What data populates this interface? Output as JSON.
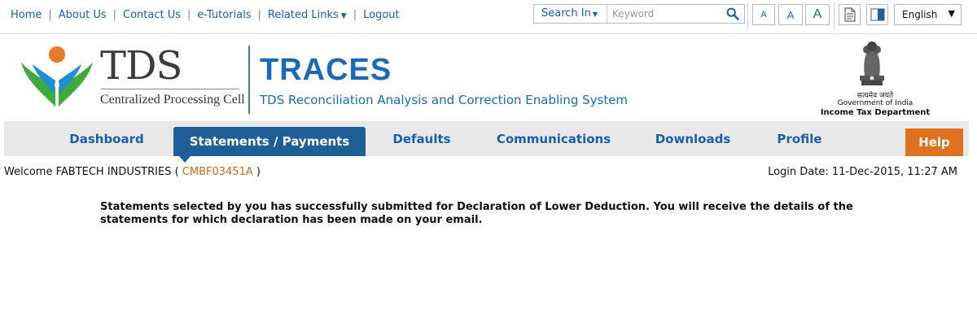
{
  "top_links": {
    "home": "Home",
    "about": "About Us",
    "contact": "Contact Us",
    "tutorials": "e-Tutorials",
    "related": "Related Links",
    "logout": "Logout"
  },
  "search": {
    "scope_label": "Search In",
    "placeholder": "Keyword",
    "value": ""
  },
  "font_size_buttons": [
    "A",
    "A",
    "A"
  ],
  "language": {
    "selected": "English"
  },
  "header": {
    "tds_logo_text": "TDS",
    "tds_sub": "Centralized Processing Cell",
    "title": "TRACES",
    "subtitle": "TDS Reconciliation Analysis and Correction Enabling System",
    "emblem_hindi": "सत्यमेव जयते",
    "gov": "Government of India",
    "dept": "Income Tax Department"
  },
  "nav": {
    "items": [
      "Dashboard",
      "Statements / Payments",
      "Defaults",
      "Communications",
      "Downloads",
      "Profile"
    ],
    "active": "Statements / Payments",
    "help": "Help"
  },
  "welcome": {
    "prefix": "Welcome FABTECH INDUSTRIES (",
    "tan": "CMBF03451A",
    "suffix": ")",
    "login_date": "Login Date: 11-Dec-2015, 11:27 AM"
  },
  "message": "Statements selected by you has successfully submitted for Declaration of Lower Deduction. You will receive the details of the statements for which declaration has been made on your email.",
  "colors": {
    "link_blue": "#1a5fa8",
    "nav_active": "#1f5f97",
    "help_orange": "#e0721f",
    "tan_orange": "#d2691e"
  }
}
